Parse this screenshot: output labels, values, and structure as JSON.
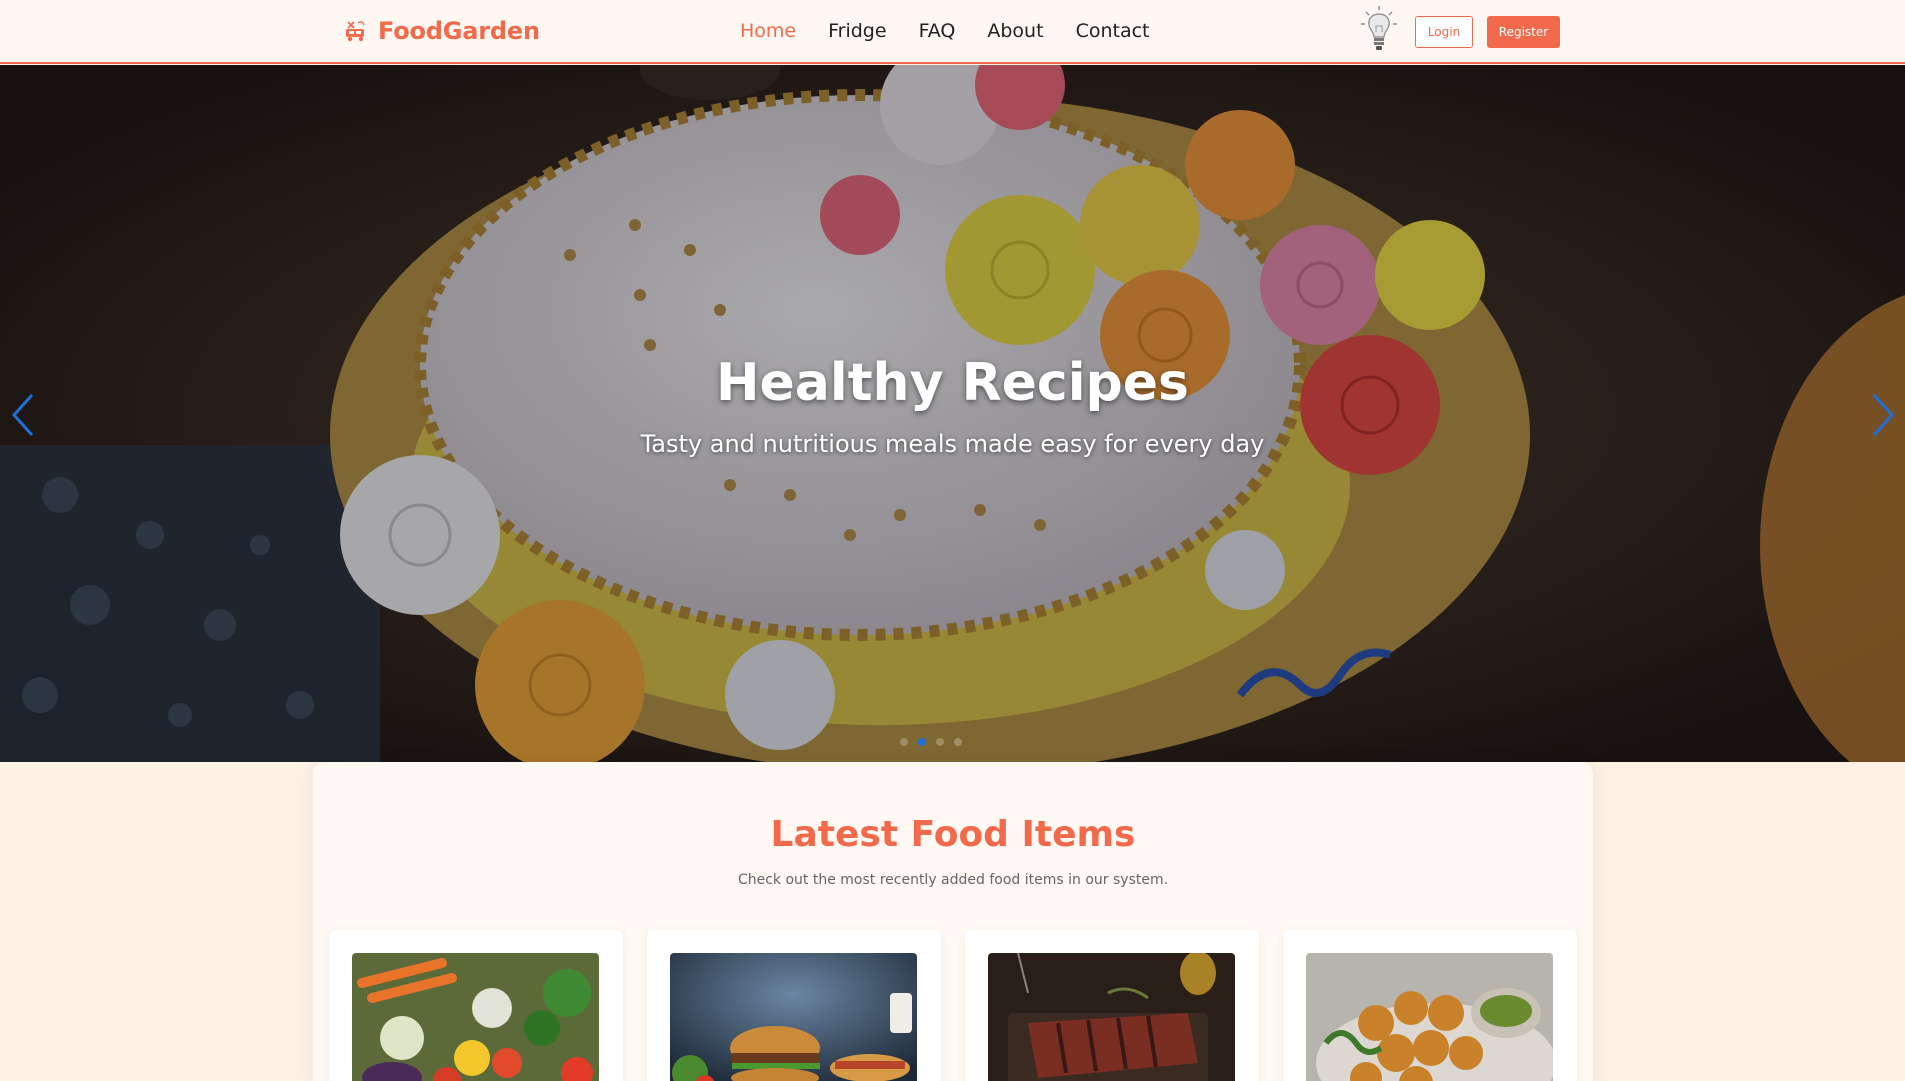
{
  "header": {
    "brand": "FoodGarden",
    "nav": [
      {
        "label": "Home",
        "active": true
      },
      {
        "label": "Fridge",
        "active": false
      },
      {
        "label": "FAQ",
        "active": false
      },
      {
        "label": "About",
        "active": false
      },
      {
        "label": "Contact",
        "active": false
      }
    ],
    "login_label": "Login",
    "register_label": "Register",
    "accent_color": "#f26a4b"
  },
  "hero": {
    "title": "Healthy Recipes",
    "subtitle": "Tasty and nutritious meals made easy for every day",
    "slides_count": 4,
    "active_slide": 2
  },
  "latest": {
    "title": "Latest Food Items",
    "subtitle": "Check out the most recently added food items in our system.",
    "items": [
      {
        "image": "vegetables-photo"
      },
      {
        "image": "burger-photo"
      },
      {
        "image": "steak-photo"
      },
      {
        "image": "falafel-photo"
      }
    ]
  }
}
